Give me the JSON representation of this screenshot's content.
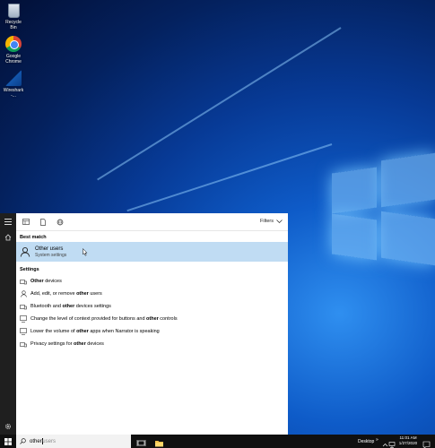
{
  "desktop": {
    "icons": [
      {
        "label": "Recycle Bin",
        "icon": "recycle-bin-icon"
      },
      {
        "label": "Google Chrome",
        "icon": "chrome-icon"
      },
      {
        "label": "Wireshark -...",
        "icon": "wireshark-icon"
      }
    ]
  },
  "start_menu": {
    "rail_icons": [
      "hamburger-icon",
      "home-icon",
      "settings-gear-icon"
    ],
    "toolbar_icons": [
      "apps-icon",
      "documents-icon",
      "web-icon"
    ],
    "filters_label": "Filters",
    "best_match_heading": "Best match",
    "best_match": {
      "title": "Other users",
      "subtitle": "System settings",
      "icon": "person-icon"
    },
    "settings_heading": "Settings",
    "results": [
      {
        "pre": "",
        "bold": "Other",
        "post": " devices"
      },
      {
        "pre": "Add, edit, or remove ",
        "bold": "other",
        "post": " users"
      },
      {
        "pre": "Bluetooth and ",
        "bold": "other",
        "post": " devices settings"
      },
      {
        "pre": "Change the level of context provided for buttons and ",
        "bold": "other",
        "post": " controls"
      },
      {
        "pre": "Lower the volume of ",
        "bold": "other",
        "post": " apps when Narrator is speaking"
      },
      {
        "pre": "Privacy settings for ",
        "bold": "other",
        "post": " devices"
      }
    ]
  },
  "taskbar": {
    "search_typed": "other",
    "search_suggestion": " users",
    "desktop_label": "Desktop",
    "tray_chevron": "»",
    "time": "11:01 AM",
    "date": "1/27/2020"
  },
  "colors": {
    "highlight": "#c0dcf3",
    "taskbar": "#101010",
    "rail": "#1f1f1f"
  }
}
